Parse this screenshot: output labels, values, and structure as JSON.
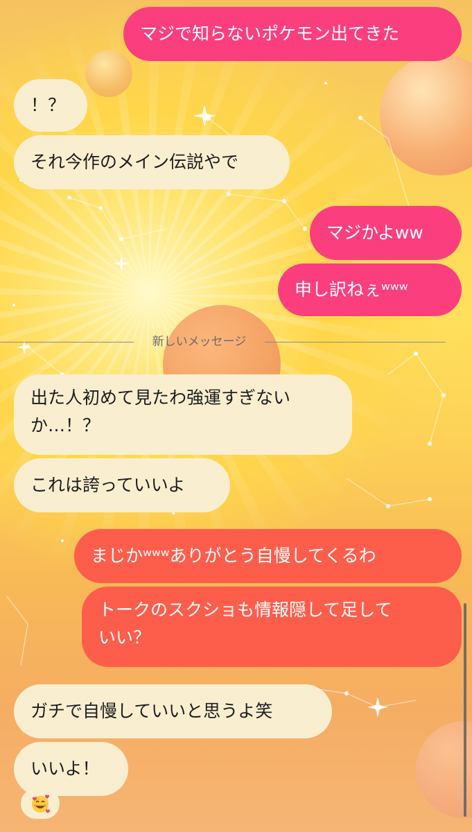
{
  "divider": {
    "label": "新しいメッセージ"
  },
  "messages": [
    {
      "id": "m1",
      "direction": "outgoing",
      "text": "マジで知らないポケモン出てきた"
    },
    {
      "id": "m2",
      "direction": "incoming",
      "text": "！？"
    },
    {
      "id": "m3",
      "direction": "incoming",
      "text": "それ今作のメイン伝説やで"
    },
    {
      "id": "m4",
      "direction": "outgoing",
      "text": "マジかよww"
    },
    {
      "id": "m5",
      "direction": "outgoing",
      "text": "申し訳ねぇʷʷʷ"
    },
    {
      "id": "m6",
      "direction": "incoming",
      "line1": "出た人初めて見たわ強運すぎない",
      "line2": "か…！？"
    },
    {
      "id": "m7",
      "direction": "incoming",
      "text": "これは誇っていいよ"
    },
    {
      "id": "m8",
      "direction": "outgoing",
      "text": "まじかʷʷʷありがとう自慢してくるわ"
    },
    {
      "id": "m9",
      "direction": "outgoing",
      "line1": "トークのスクショも情報隠して足して",
      "line2": "いい？"
    },
    {
      "id": "m10",
      "direction": "incoming",
      "text": "ガチで自慢していいと思うよ笑"
    },
    {
      "id": "m11",
      "direction": "incoming",
      "text": "いいよ！"
    }
  ],
  "reaction": {
    "icon": "smiling-face-with-hearts-icon"
  },
  "colors": {
    "outgoing_pink": "#fb3e7d",
    "outgoing_orange": "#fd5d4b",
    "incoming": "#f9efd0"
  }
}
